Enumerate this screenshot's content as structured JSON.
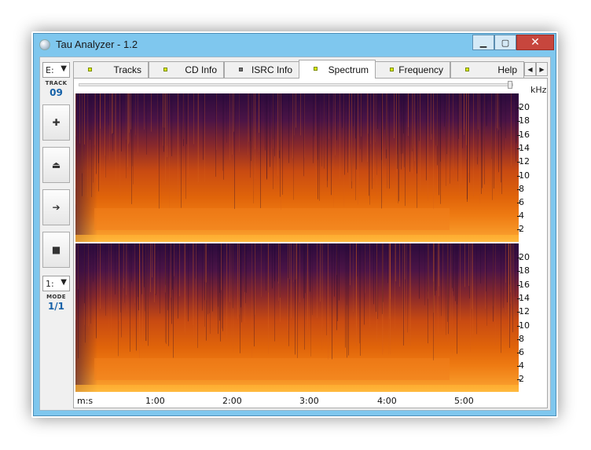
{
  "window": {
    "title": "Tau Analyzer - 1.2"
  },
  "toolbar": {
    "drive_value": "E:",
    "track_label": "TRACK",
    "track_value": "09",
    "add_icon": "plus-icon",
    "eject_icon": "eject-icon",
    "play_icon": "arrow-right-icon",
    "stop_icon": "stop-icon",
    "mode_select_value": "1:",
    "mode_label": "MODE",
    "mode_value": "1/1"
  },
  "tabs": [
    {
      "label": "Tracks",
      "active": false
    },
    {
      "label": "CD Info",
      "active": false
    },
    {
      "label": "ISRC Info",
      "active": false
    },
    {
      "label": "Spectrum",
      "active": true
    },
    {
      "label": "Frequency",
      "active": false
    },
    {
      "label": "Help",
      "active": false
    }
  ],
  "spectrum": {
    "unit_label": "kHz",
    "freq_ticks": [
      "20",
      "18",
      "16",
      "14",
      "12",
      "10",
      "8",
      "6",
      "4",
      "2"
    ],
    "time_unit": "m:s",
    "time_ticks": [
      "1:00",
      "2:00",
      "3:00",
      "4:00",
      "5:00"
    ]
  }
}
